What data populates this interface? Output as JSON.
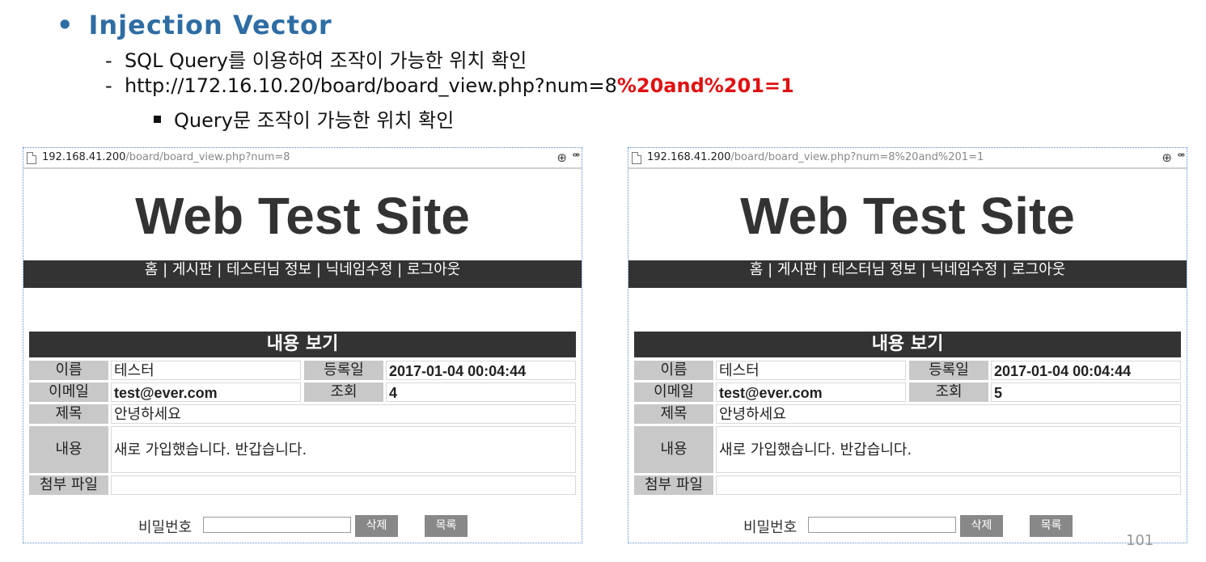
{
  "slide": {
    "bullet": "•",
    "heading": "Injection Vector",
    "line1": "SQL Query를 이용하여 조작이 가능한 위치 확인",
    "line2_prefix": "http://172.16.10.20/board/board_view.php?num=8",
    "line2_highlight": "%20and%201=1",
    "line3": "Query문 조작이 가능한 위치 확인",
    "dash": "-",
    "page_number": "101"
  },
  "panels": [
    {
      "url_host": "192.168.41.200",
      "url_path": "/board/board_view.php?num=8",
      "site_title": "Web Test Site",
      "nav": "홈 | 게시판 | 테스터님 정보 | 닉네임수정 | 로그아웃",
      "view_title": "내용 보기",
      "name_label": "이름",
      "name_value": "테스터",
      "date_label": "등록일",
      "date_value": "2017-01-04 00:04:44",
      "email_label": "이메일",
      "email_value": "test@ever.com",
      "views_label": "조회",
      "views_value": "4",
      "subject_label": "제목",
      "subject_value": "안녕하세요",
      "content_label": "내용",
      "content_value": "새로 가입했습니다. 반갑습니다.",
      "attach_label": "첨부 파일",
      "attach_value": "",
      "password_label": "비밀번호",
      "delete_button": "삭제",
      "list_button": "목록"
    },
    {
      "url_host": "192.168.41.200",
      "url_path": "/board/board_view.php?num=8%20and%201=1",
      "site_title": "Web Test Site",
      "nav": "홈 | 게시판 | 테스터님 정보 | 닉네임수정 | 로그아웃",
      "view_title": "내용 보기",
      "name_label": "이름",
      "name_value": "테스터",
      "date_label": "등록일",
      "date_value": "2017-01-04 00:04:44",
      "email_label": "이메일",
      "email_value": "test@ever.com",
      "views_label": "조회",
      "views_value": "5",
      "subject_label": "제목",
      "subject_value": "안녕하세요",
      "content_label": "내용",
      "content_value": "새로 가입했습니다. 반갑습니다.",
      "attach_label": "첨부 파일",
      "attach_value": "",
      "password_label": "비밀번호",
      "delete_button": "삭제",
      "list_button": "목록"
    }
  ]
}
